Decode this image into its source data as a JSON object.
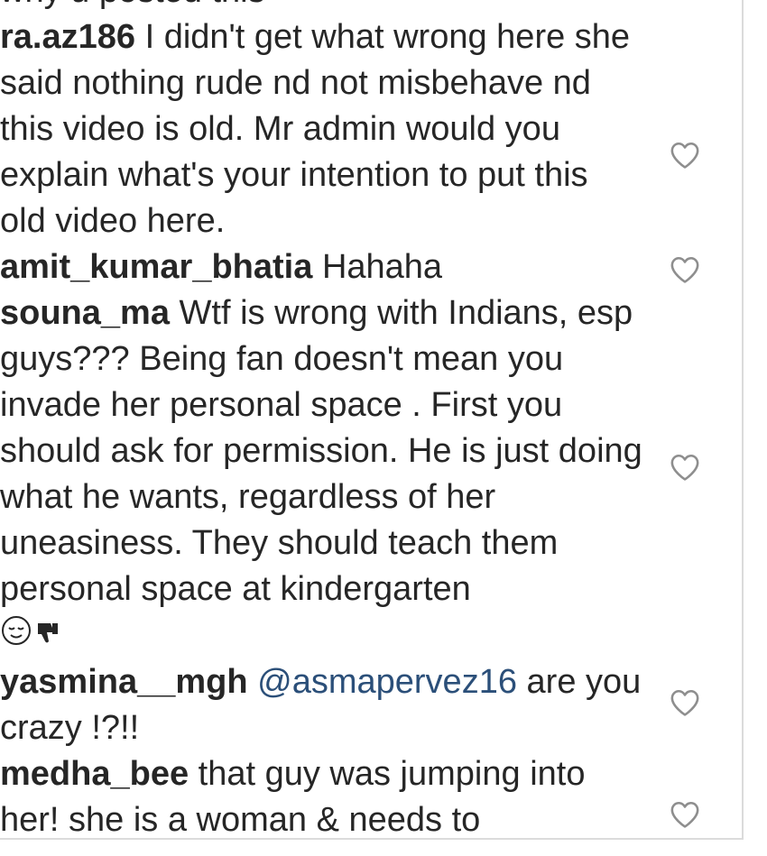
{
  "comments": [
    {
      "username": "",
      "text": "why u posted this"
    },
    {
      "username": "ra.az186",
      "text": "I didn't get what wrong here she said nothing rude nd not misbehave nd this video is old. Mr admin would you explain what's your intention to put this old video here."
    },
    {
      "username": "amit_kumar_bhatia",
      "text": "Hahaha"
    },
    {
      "username": "souna_ma",
      "text": "Wtf is wrong with Indians, esp guys??? Being fan doesn't mean you invade her personal space . First you should ask for permission. He is just doing what he wants, regardless of her uneasiness. They should teach them personal space at kindergarten",
      "emojis": [
        "relieved-face-icon",
        "thumbs-down-icon"
      ]
    },
    {
      "username": "yasmina__mgh",
      "mention": "@asmapervez16",
      "text": "are you crazy !?!!"
    },
    {
      "username": "medha_bee",
      "text": "that guy was jumping into her! she is a woman & needs to"
    }
  ],
  "icons": {
    "like": "heart-outline-icon"
  },
  "colors": {
    "text": "#262626",
    "mention": "#2b4f79",
    "icon_stroke": "#8e8e8e",
    "border": "#dbdbdb"
  }
}
